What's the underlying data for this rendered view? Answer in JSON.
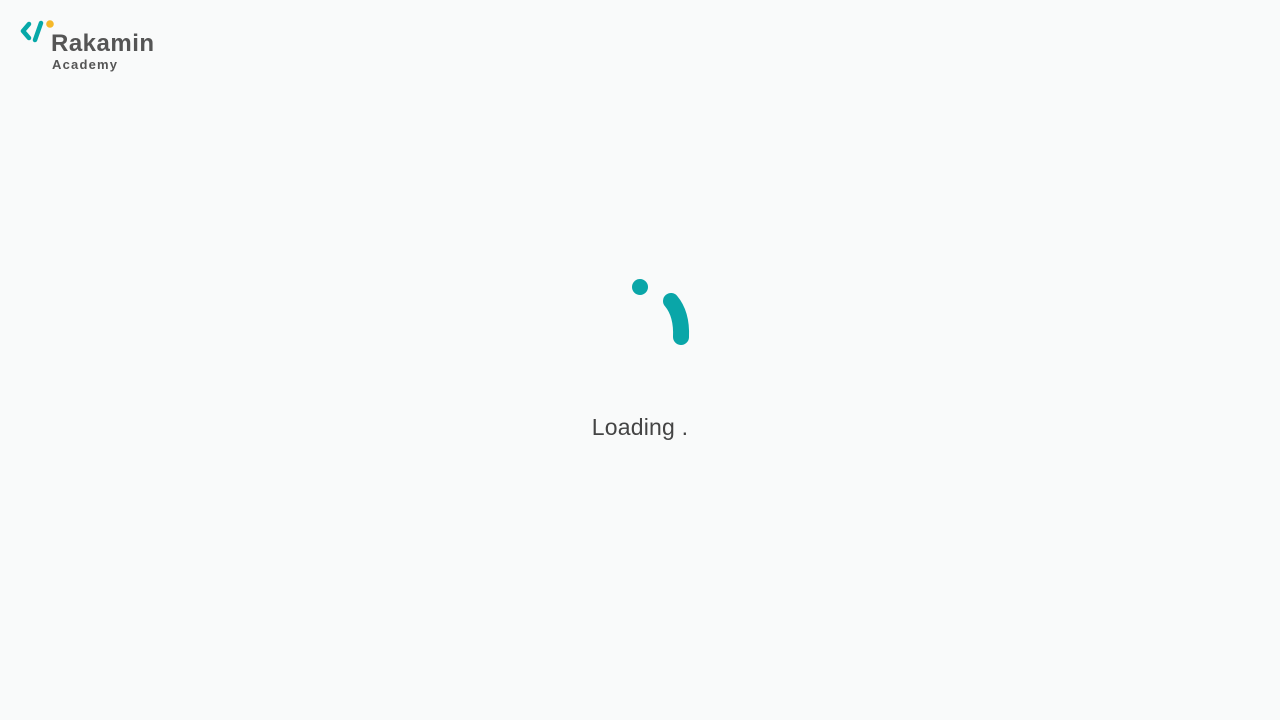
{
  "brand": {
    "name": "Rakamin",
    "subtitle": "Academy",
    "colors": {
      "primary": "#06a8a8",
      "accent": "#f5b829",
      "text": "#555555"
    }
  },
  "loader": {
    "text": "Loading .",
    "icon": "spinner-icon",
    "color": "#0aa6a8"
  },
  "page": {
    "background": "#f9fafa"
  }
}
